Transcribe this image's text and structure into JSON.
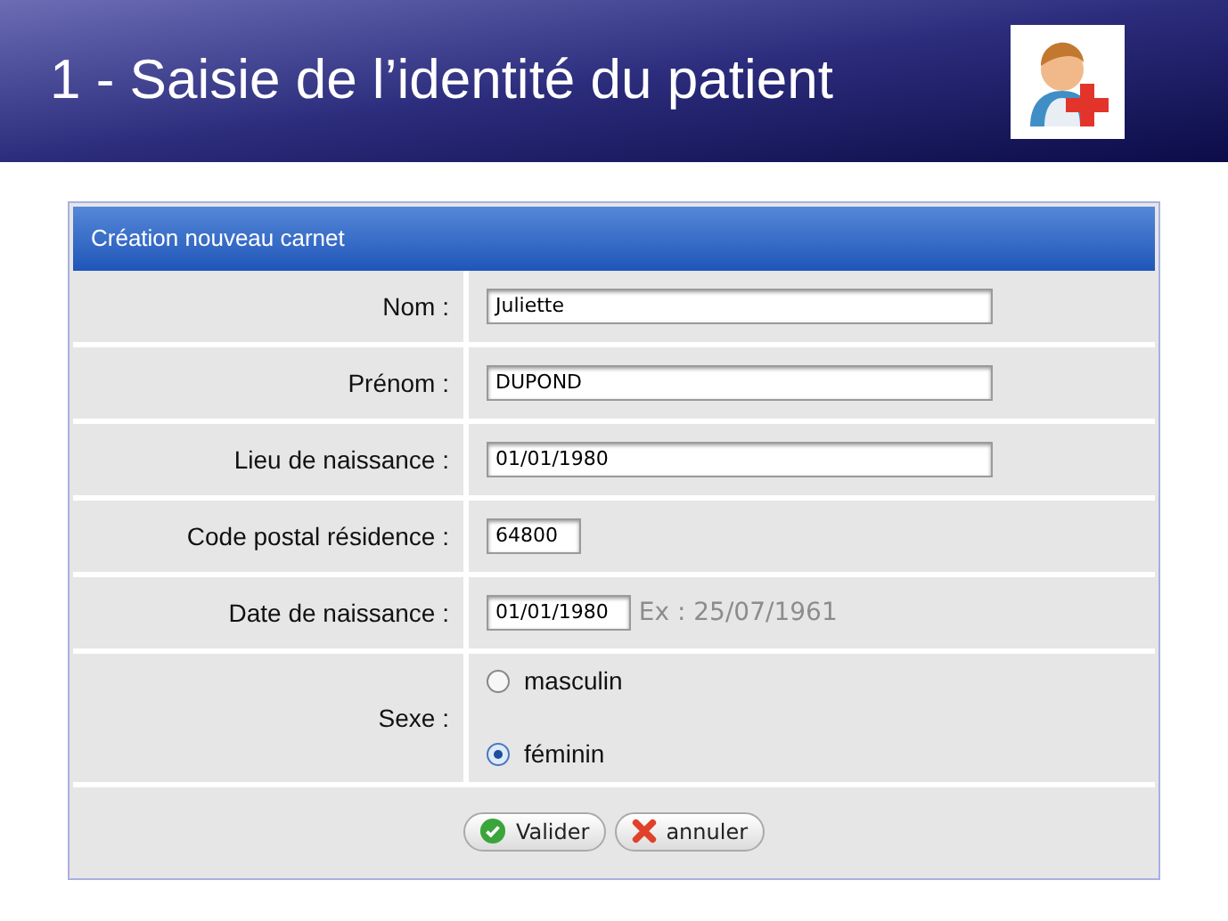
{
  "slide": {
    "title": "1 - Saisie de l’identité du patient"
  },
  "form": {
    "title": "Création nouveau carnet",
    "rows": [
      {
        "kind": "text",
        "label": "Nom :",
        "value": "Juliette"
      },
      {
        "kind": "text",
        "label": "Prénom :",
        "value": "DUPOND"
      },
      {
        "kind": "text",
        "label": "Lieu de naissance :",
        "value": "01/01/1980"
      },
      {
        "kind": "code",
        "label": "Code postal résidence :",
        "value": "64800"
      },
      {
        "kind": "date",
        "label": "Date de naissance :",
        "value": "01/01/1980",
        "hint": "Ex : 25/07/1961"
      },
      {
        "kind": "radio",
        "label": "Sexe :",
        "options": [
          {
            "label": "masculin",
            "selected": false
          },
          {
            "label": "féminin",
            "selected": true
          }
        ]
      }
    ],
    "buttons": [
      {
        "kind": "ok",
        "label": "Valider"
      },
      {
        "kind": "cancel",
        "label": "annuler"
      }
    ]
  }
}
